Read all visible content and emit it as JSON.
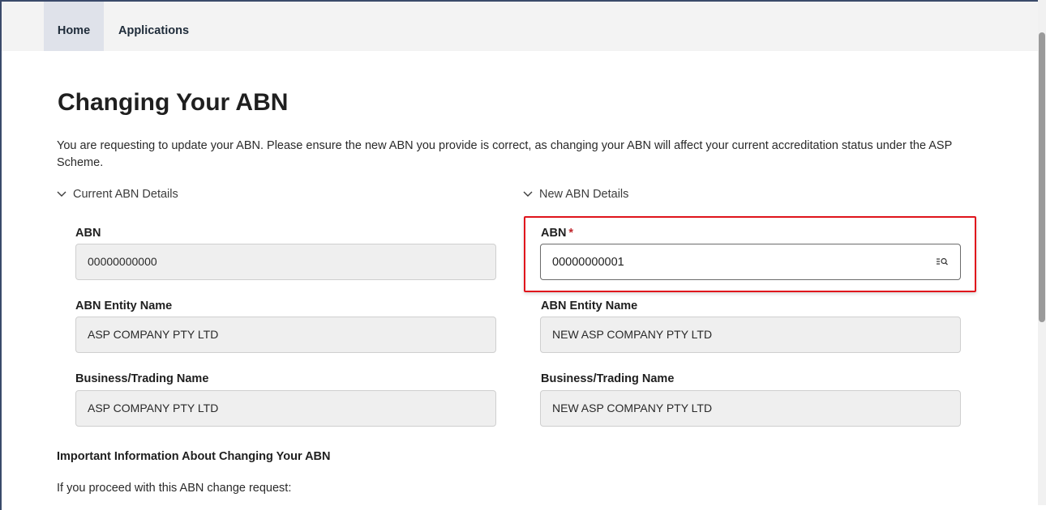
{
  "nav": {
    "items": [
      {
        "label": "Home"
      },
      {
        "label": "Applications"
      }
    ]
  },
  "page": {
    "title": "Changing Your ABN",
    "intro": "You are requesting to update your ABN. Please ensure the new ABN you provide is correct, as changing your ABN will affect your current accreditation status under the ASP Scheme."
  },
  "current": {
    "section_label": "Current ABN Details",
    "abn_label": "ABN",
    "abn_value": "00000000000",
    "entity_label": "ABN Entity Name",
    "entity_value": "ASP COMPANY PTY LTD",
    "business_label": "Business/Trading Name",
    "business_value": "ASP COMPANY PTY LTD"
  },
  "new": {
    "section_label": "New ABN Details",
    "abn_label": "ABN",
    "abn_required_marker": "*",
    "abn_value": "00000000001",
    "entity_label": "ABN Entity Name",
    "entity_value": "NEW ASP COMPANY PTY LTD",
    "business_label": "Business/Trading Name",
    "business_value": "NEW ASP COMPANY PTY LTD"
  },
  "info": {
    "heading": "Important Information About Changing Your ABN",
    "text": "If you proceed with this ABN change request:"
  },
  "icons": {
    "section_toggle": "chevron-down-icon",
    "abn_lookup": "search-list-icon"
  },
  "colors": {
    "highlight": "#e0141c",
    "required": "#c0272d",
    "nav_active": "#dfe2ea"
  }
}
